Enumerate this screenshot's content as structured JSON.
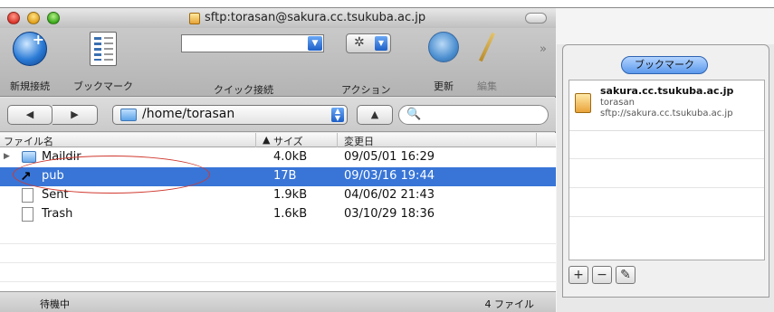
{
  "window": {
    "title": "sftp:torasan@sakura.cc.tsukuba.ac.jp"
  },
  "toolbar": {
    "new_connection": "新規接続",
    "bookmark": "ブックマーク",
    "quick_connect": "クイック接続",
    "quick_connect_value": "",
    "action": "アクション",
    "refresh": "更新",
    "edit": "編集"
  },
  "navbar": {
    "path": "/home/torasan",
    "search_value": ""
  },
  "table": {
    "columns": {
      "name": "ファイル名",
      "size": "サイズ",
      "modified": "変更日"
    },
    "rows": [
      {
        "name": "Maildir",
        "size": "4.0kB",
        "modified": "09/05/01 16:29",
        "kind": "folder-icon"
      },
      {
        "name": "pub",
        "size": "17B",
        "modified": "09/03/16 19:44",
        "kind": "symlink-icon",
        "selected": true
      },
      {
        "name": "Sent",
        "size": "1.9kB",
        "modified": "04/06/02 21:43",
        "kind": "document-icon"
      },
      {
        "name": "Trash",
        "size": "1.6kB",
        "modified": "03/10/29 18:36",
        "kind": "document-icon"
      }
    ]
  },
  "status": {
    "left": "待機中",
    "right": "4 ファイル"
  },
  "bookmarks_panel": {
    "tab": "ブックマーク",
    "items": [
      {
        "title": "sakura.cc.tsukuba.ac.jp",
        "user": "torasan",
        "url": "sftp://sakura.cc.tsukuba.ac.jp"
      }
    ],
    "add": "+",
    "remove": "−"
  },
  "colors": {
    "selection": "#3875d7",
    "annotation": "#d0392f"
  }
}
